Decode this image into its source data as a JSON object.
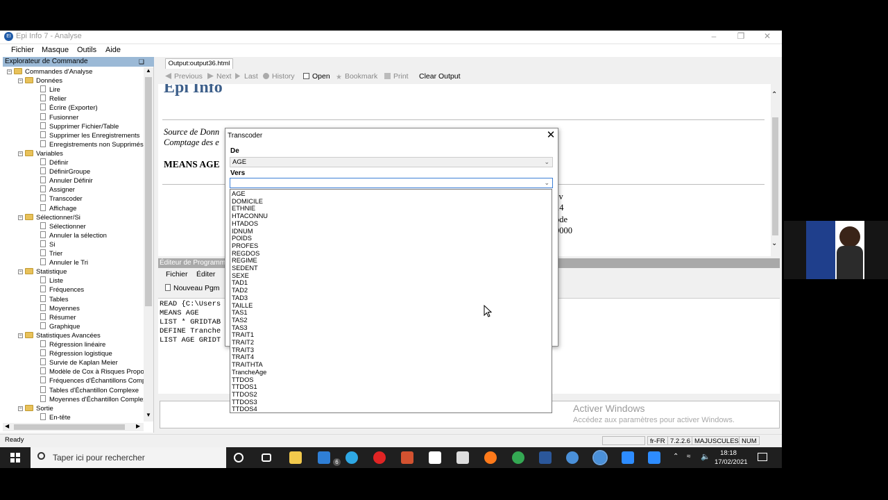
{
  "window": {
    "title": "Epi Info 7 - Analyse",
    "menu": [
      "Fichier",
      "Masque",
      "Outils",
      "Aide"
    ]
  },
  "explorer": {
    "header": "Explorateur de Commande",
    "pin": "❑",
    "tree": [
      {
        "label": "Commandes d'Analyse",
        "level": 0,
        "type": "folder"
      },
      {
        "label": "Données",
        "level": 1,
        "type": "folder"
      },
      {
        "label": "Lire",
        "level": 2,
        "type": "leaf"
      },
      {
        "label": "Relier",
        "level": 2,
        "type": "leaf"
      },
      {
        "label": "Écrire (Exporter)",
        "level": 2,
        "type": "leaf"
      },
      {
        "label": "Fusionner",
        "level": 2,
        "type": "leaf"
      },
      {
        "label": "Supprimer Fichier/Table",
        "level": 2,
        "type": "leaf"
      },
      {
        "label": "Supprimer les Enregistrements",
        "level": 2,
        "type": "leaf"
      },
      {
        "label": "Enregistrements non Supprimés",
        "level": 2,
        "type": "leaf"
      },
      {
        "label": "Variables",
        "level": 1,
        "type": "folder"
      },
      {
        "label": "Définir",
        "level": 2,
        "type": "leaf"
      },
      {
        "label": "DéfinirGroupe",
        "level": 2,
        "type": "leaf"
      },
      {
        "label": "Annuler Définir",
        "level": 2,
        "type": "leaf"
      },
      {
        "label": "Assigner",
        "level": 2,
        "type": "leaf"
      },
      {
        "label": "Transcoder",
        "level": 2,
        "type": "leaf"
      },
      {
        "label": "Affichage",
        "level": 2,
        "type": "leaf"
      },
      {
        "label": "Sélectionner/Si",
        "level": 1,
        "type": "folder"
      },
      {
        "label": "Sélectionner",
        "level": 2,
        "type": "leaf"
      },
      {
        "label": "Annuler la sélection",
        "level": 2,
        "type": "leaf"
      },
      {
        "label": "Si",
        "level": 2,
        "type": "leaf"
      },
      {
        "label": "Trier",
        "level": 2,
        "type": "leaf"
      },
      {
        "label": "Annuler le Tri",
        "level": 2,
        "type": "leaf"
      },
      {
        "label": "Statistique",
        "level": 1,
        "type": "folder"
      },
      {
        "label": "Liste",
        "level": 2,
        "type": "leaf"
      },
      {
        "label": "Fréquences",
        "level": 2,
        "type": "leaf"
      },
      {
        "label": "Tables",
        "level": 2,
        "type": "leaf"
      },
      {
        "label": "Moyennes",
        "level": 2,
        "type": "leaf"
      },
      {
        "label": "Résumer",
        "level": 2,
        "type": "leaf"
      },
      {
        "label": "Graphique",
        "level": 2,
        "type": "leaf"
      },
      {
        "label": "Statistiques Avancées",
        "level": 1,
        "type": "folder"
      },
      {
        "label": "Régression linéaire",
        "level": 2,
        "type": "leaf"
      },
      {
        "label": "Régression logistique",
        "level": 2,
        "type": "leaf"
      },
      {
        "label": "Survie de Kaplan Meier",
        "level": 2,
        "type": "leaf"
      },
      {
        "label": "Modèle de Cox à Risques Proportio",
        "level": 2,
        "type": "leaf"
      },
      {
        "label": "Fréquences d'Échantillons Comple:",
        "level": 2,
        "type": "leaf"
      },
      {
        "label": "Tables d'Échantillon Complexe",
        "level": 2,
        "type": "leaf"
      },
      {
        "label": "Moyennes d'Échantillon Complexe",
        "level": 2,
        "type": "leaf"
      },
      {
        "label": "Sortie",
        "level": 1,
        "type": "folder"
      },
      {
        "label": "En-tête",
        "level": 2,
        "type": "leaf"
      }
    ]
  },
  "output": {
    "tab": "Output:output36.html",
    "toolbar": {
      "previous": "Previous",
      "next": "Next",
      "last": "Last",
      "history": "History",
      "open": "Open",
      "bookmark": "Bookmark",
      "print": "Print",
      "clear": "Clear Output"
    },
    "title": "Epi Info",
    "source_line": "Source de Donn",
    "count_line": "Comptage des e",
    "means": "MEANS AGE",
    "right_fragments": [
      "ev",
      "14",
      "ode",
      "0000"
    ]
  },
  "program": {
    "header": "Éditeur de Programme",
    "menu": [
      "Fichier",
      "Éditer"
    ],
    "new_pgm": "Nouveau Pgm",
    "lines": [
      "READ {C:\\Users",
      "MEANS AGE",
      "LIST * GRIDTAB",
      "DEFINE Tranche",
      "LIST AGE GRIDT"
    ]
  },
  "watermark": {
    "title": "Activer Windows",
    "subtitle": "Accédez aux paramètres pour activer Windows."
  },
  "status": {
    "ready": "Ready",
    "locale": "fr-FR",
    "version": "7.2.2.6",
    "caps": "MAJUSCULES",
    "num": "NUM"
  },
  "dialog": {
    "title": "Transcoder",
    "close": "✕",
    "from_label": "De",
    "from_value": "AGE",
    "to_label": "Vers",
    "to_value": "",
    "options": [
      "AGE",
      "DOMICILE",
      "ETHNIE",
      "HTACONNU",
      "HTADOS",
      "IDNUM",
      "POIDS",
      "PROFES",
      "REGDOS",
      "REGIME",
      "SEDENT",
      "SEXE",
      "TAD1",
      "TAD2",
      "TAD3",
      "TAILLE",
      "TAS1",
      "TAS2",
      "TAS3",
      "TRAIT1",
      "TRAIT2",
      "TRAIT3",
      "TRAIT4",
      "TRAITHTA",
      "TrancheAge",
      "TTDOS",
      "TTDOS1",
      "TTDOS2",
      "TTDOS3",
      "TTDOS4"
    ]
  },
  "taskbar": {
    "search_placeholder": "Taper ici pour rechercher",
    "mail_badge": "6",
    "time": "18:18",
    "date": "17/02/2021",
    "icons": [
      {
        "name": "cortana",
        "color": "#ffffff"
      },
      {
        "name": "task-view",
        "color": "#ffffff"
      },
      {
        "name": "file-explorer",
        "color": "#f2c94c"
      },
      {
        "name": "mail",
        "color": "#2f7fd6"
      },
      {
        "name": "edge",
        "color": "#2ea8e5"
      },
      {
        "name": "opera",
        "color": "#e02424"
      },
      {
        "name": "powerpoint",
        "color": "#d35230"
      },
      {
        "name": "document",
        "color": "#ffffff"
      },
      {
        "name": "store",
        "color": "#dddddd"
      },
      {
        "name": "firefox",
        "color": "#ff7a1a"
      },
      {
        "name": "chrome",
        "color": "#34a853"
      },
      {
        "name": "word",
        "color": "#2b579a"
      },
      {
        "name": "epi-info",
        "color": "#4a90d9"
      },
      {
        "name": "epi-info-active",
        "color": "#4a90d9"
      },
      {
        "name": "zoom",
        "color": "#2d8cff"
      },
      {
        "name": "zoom-meetings",
        "color": "#2d8cff"
      }
    ]
  }
}
